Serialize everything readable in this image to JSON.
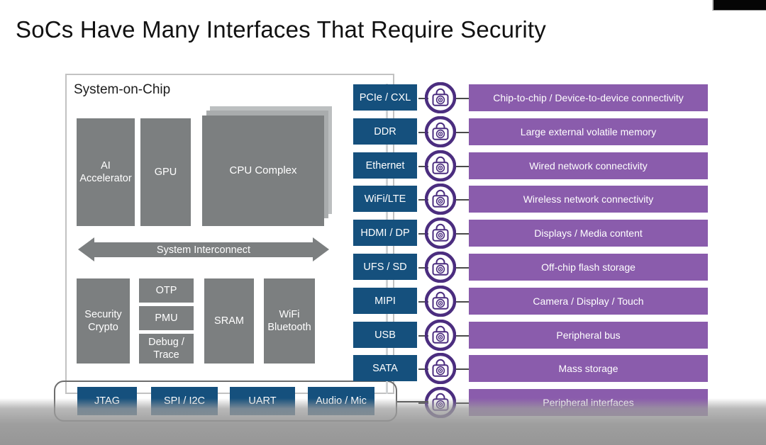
{
  "slide": {
    "title": "SoCs Have Many Interfaces That Require Security"
  },
  "soc": {
    "panel_title": "System-on-Chip",
    "interconnect_label": "System Interconnect",
    "blocks": [
      {
        "id": "ai-accelerator",
        "label": "AI\nAccelerator"
      },
      {
        "id": "gpu",
        "label": "GPU"
      },
      {
        "id": "cpu-complex",
        "label": "CPU Complex"
      },
      {
        "id": "security-crypto",
        "label": "Security\nCrypto"
      },
      {
        "id": "otp",
        "label": "OTP"
      },
      {
        "id": "pmu",
        "label": "PMU"
      },
      {
        "id": "debug-trace",
        "label": "Debug /\nTrace"
      },
      {
        "id": "sram",
        "label": "SRAM"
      },
      {
        "id": "wifi-bluetooth",
        "label": "WiFi\nBluetooth"
      }
    ],
    "block_labels": {
      "ai_line1": "AI",
      "ai_line2": "Accelerator",
      "gpu": "GPU",
      "cpu": "CPU Complex",
      "security_line1": "Security",
      "security_line2": "Crypto",
      "otp": "OTP",
      "pmu": "PMU",
      "debug_line1": "Debug /",
      "debug_line2": "Trace",
      "sram": "SRAM",
      "wifibt_line1": "WiFi",
      "wifibt_line2": "Bluetooth"
    }
  },
  "peripheral_row": {
    "items": [
      {
        "label": "JTAG"
      },
      {
        "label": "SPI / I2C"
      },
      {
        "label": "UART"
      },
      {
        "label": "Audio / Mic"
      }
    ]
  },
  "interfaces": [
    {
      "name": "PCIe / CXL",
      "description": "Chip-to-chip / Device-to-device connectivity",
      "lock": "padlock-icon"
    },
    {
      "name": "DDR",
      "description": "Large external volatile memory",
      "lock": "padlock-icon"
    },
    {
      "name": "Ethernet",
      "description": "Wired network connectivity",
      "lock": "padlock-icon"
    },
    {
      "name": "WiFi/LTE",
      "description": "Wireless network connectivity",
      "lock": "padlock-icon"
    },
    {
      "name": "HDMI / DP",
      "description": "Displays / Media content",
      "lock": "padlock-icon"
    },
    {
      "name": "UFS / SD",
      "description": "Off-chip flash storage",
      "lock": "padlock-icon"
    },
    {
      "name": "MIPI",
      "description": "Camera / Display / Touch",
      "lock": "padlock-icon"
    },
    {
      "name": "USB",
      "description": "Peripheral bus",
      "lock": "padlock-icon"
    },
    {
      "name": "SATA",
      "description": "Mass storage",
      "lock": "padlock-icon"
    },
    {
      "name": "",
      "description": "Peripheral interfaces",
      "lock": "padlock-icon"
    }
  ],
  "colors": {
    "interface_blue": "#15507d",
    "description_purple": "#8a5cac",
    "block_gray": "#7c7f80",
    "lock_purple": "#4b2d7f",
    "panel_border": "#c2c2c2"
  }
}
